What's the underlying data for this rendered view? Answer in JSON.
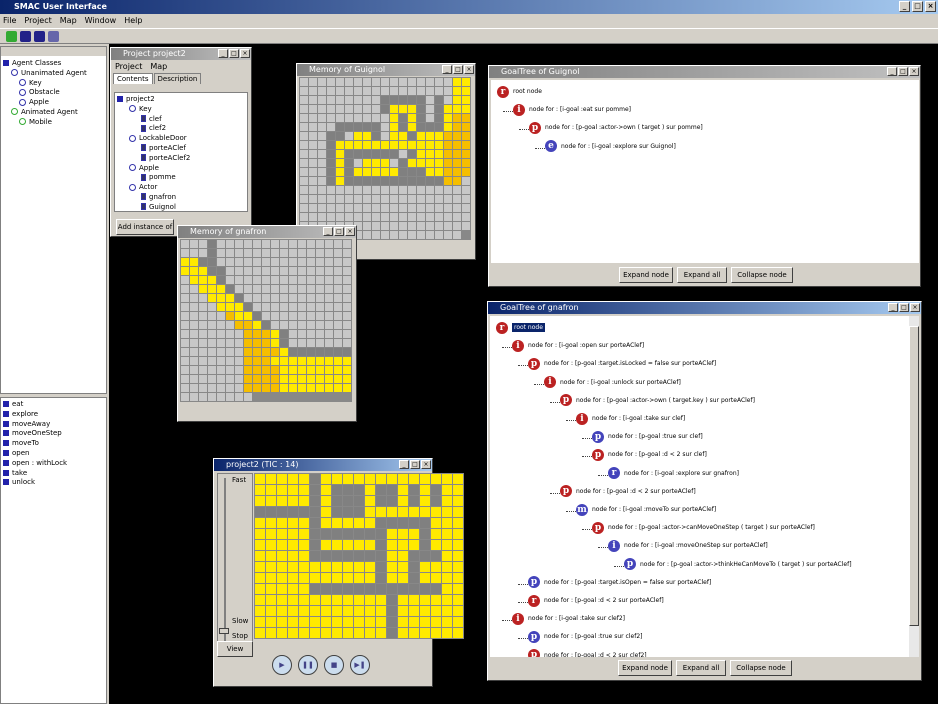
{
  "app": {
    "title": "SMAC User Interface"
  },
  "menu": [
    "File",
    "Project",
    "Map",
    "Window",
    "Help"
  ],
  "agent_tree": [
    {
      "label": "Agent Classes",
      "level": 0,
      "icon": "class-icon"
    },
    {
      "label": "Unanimated Agent",
      "level": 1,
      "icon": "agent-icon"
    },
    {
      "label": "Key",
      "level": 2,
      "icon": "agent-icon"
    },
    {
      "label": "Obstacle",
      "level": 2,
      "icon": "agent-icon"
    },
    {
      "label": "Apple",
      "level": 2,
      "icon": "agent-icon"
    },
    {
      "label": "Animated Agent",
      "level": 1,
      "icon": "animated-agent-icon"
    },
    {
      "label": "Mobile",
      "level": 2,
      "icon": "animated-agent-icon"
    }
  ],
  "actions": [
    "eat",
    "explore",
    "moveAway",
    "moveOneStep",
    "moveTo",
    "open",
    "open : withLock",
    "take",
    "unlock"
  ],
  "project": {
    "title": "Project project2",
    "menu": [
      "Project",
      "Map"
    ],
    "tabs": [
      "Contents",
      "Description"
    ],
    "tree": [
      {
        "label": "project2",
        "level": 0
      },
      {
        "label": "Key",
        "level": 1
      },
      {
        "label": "clef",
        "level": 2
      },
      {
        "label": "clef2",
        "level": 2
      },
      {
        "label": "LockableDoor",
        "level": 1
      },
      {
        "label": "porteAClef",
        "level": 2
      },
      {
        "label": "porteAClef2",
        "level": 2
      },
      {
        "label": "Apple",
        "level": 1
      },
      {
        "label": "pomme",
        "level": 2
      },
      {
        "label": "Actor",
        "level": 1
      },
      {
        "label": "gnafron",
        "level": 2
      },
      {
        "label": "Guignol",
        "level": 2
      }
    ],
    "add_button": "Add instance of"
  },
  "mem_guignol": {
    "title": "Memory of Guignol"
  },
  "mem_gnafron": {
    "title": "Memory of gnafron"
  },
  "sim": {
    "title": "project2 (TIC : 14)",
    "fast": "Fast",
    "slow": "Slow",
    "stop": "Stop",
    "view": "View"
  },
  "goal_guignol": {
    "title": "GoalTree of Guignol",
    "nodes": [
      {
        "k": "r",
        "text": "root node",
        "level": 0,
        "color": "#b22"
      },
      {
        "k": "i",
        "text": "node for : [i-goal :eat sur pomme]",
        "level": 1,
        "color": "#b22"
      },
      {
        "k": "p",
        "text": "node for : [p-goal :actor->own ( target ) sur pomme]",
        "level": 2,
        "color": "#b22"
      },
      {
        "k": "e",
        "text": "node for : [i-goal :explore sur Guignol]",
        "level": 3,
        "color": "#44b"
      }
    ],
    "buttons": [
      "Expand node",
      "Expand all",
      "Collapse node"
    ]
  },
  "goal_gnafron": {
    "title": "GoalTree of gnafron",
    "nodes": [
      {
        "k": "r",
        "text": "root node",
        "level": 0,
        "color": "#b22",
        "sel": true
      },
      {
        "k": "i",
        "text": "node for : [i-goal :open sur porteAClef]",
        "level": 1,
        "color": "#b22"
      },
      {
        "k": "p",
        "text": "node for : [p-goal :target.isLocked = false sur porteAClef]",
        "level": 2,
        "color": "#b22"
      },
      {
        "k": "i",
        "text": "node for : [i-goal :unlock sur porteAClef]",
        "level": 3,
        "color": "#b22"
      },
      {
        "k": "p",
        "text": "node for : [p-goal :actor->own ( target.key ) sur porteAClef]",
        "level": 4,
        "color": "#b22"
      },
      {
        "k": "i",
        "text": "node for : [i-goal :take sur clef]",
        "level": 5,
        "color": "#b22"
      },
      {
        "k": "p",
        "text": "node for : [p-goal :true sur clef]",
        "level": 6,
        "color": "#44b"
      },
      {
        "k": "p",
        "text": "node for : [p-goal :d < 2 sur clef]",
        "level": 6,
        "color": "#b22"
      },
      {
        "k": "r",
        "text": "node for : [i-goal :explore sur gnafron]",
        "level": 7,
        "color": "#44b"
      },
      {
        "k": "p",
        "text": "node for : [p-goal :d < 2 sur porteAClef]",
        "level": 4,
        "color": "#b22"
      },
      {
        "k": "m",
        "text": "node for : [i-goal :moveTo sur porteAClef]",
        "level": 5,
        "color": "#44b"
      },
      {
        "k": "p",
        "text": "node for : [p-goal :actor->canMoveOneStep ( target ) sur porteAClef]",
        "level": 6,
        "color": "#b22"
      },
      {
        "k": "i",
        "text": "node for : [i-goal :moveOneStep sur porteAClef]",
        "level": 7,
        "color": "#44b"
      },
      {
        "k": "p",
        "text": "node for : [p-goal :actor->thinkHeCanMoveTo ( target ) sur porteAClef]",
        "level": 8,
        "color": "#44b"
      },
      {
        "k": "p",
        "text": "node for : [p-goal :target.isOpen = false sur porteAClef]",
        "level": 2,
        "color": "#44b"
      },
      {
        "k": "r",
        "text": "node for : [p-goal :d < 2 sur porteAClef]",
        "level": 2,
        "color": "#b22"
      },
      {
        "k": "i",
        "text": "node for : [i-goal :take sur clef2]",
        "level": 1,
        "color": "#b22"
      },
      {
        "k": "p",
        "text": "node for : [p-goal :true sur clef2]",
        "level": 2,
        "color": "#44b"
      },
      {
        "k": "p",
        "text": "node for : [p-goal :d < 2 sur clef2]",
        "level": 2,
        "color": "#b22"
      }
    ],
    "buttons": [
      "Expand node",
      "Expand all",
      "Collapse node"
    ]
  }
}
